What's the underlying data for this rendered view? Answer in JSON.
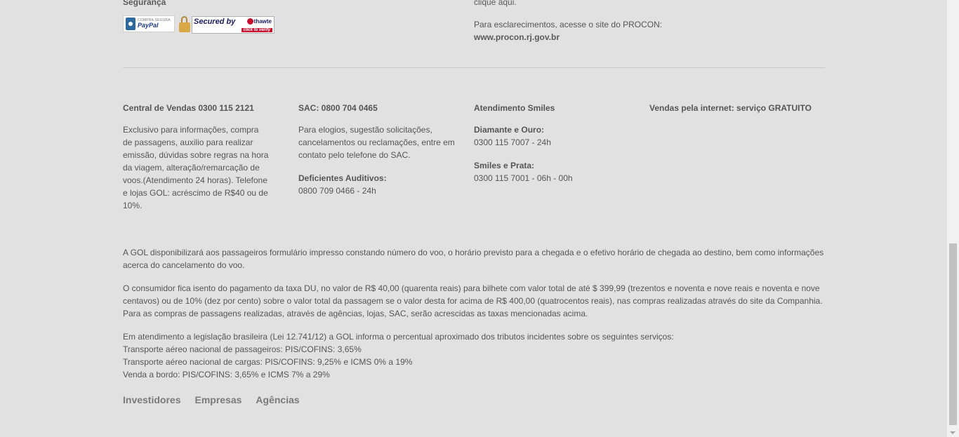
{
  "security": {
    "title": "Segurança",
    "paypal_small": "COMPRA SEGURA",
    "paypal_brand": "PayPal",
    "thawte_secured": "Secured by",
    "thawte_brand": "thawte",
    "thawte_verify": "click to verify"
  },
  "procon": {
    "clique_aqui": "clique aqui.",
    "text": "Para esclarecimentos, acesse o site do PROCON:",
    "link": "www.procon.rj.gov.br"
  },
  "columns": {
    "central": {
      "title": "Central de Vendas 0300 115 2121",
      "text": "Exclusivo para informações, compra de passagens, auxilio para realizar emissão, dúvidas sobre regras na hora da viagem, alteração/remarcação de voos.(Atendimento 24 horas). Telefone e lojas GOL: acréscimo de R$40 ou de 10%."
    },
    "sac": {
      "title": "SAC: 0800 704 0465",
      "text": "Para elogios, sugestão solicitações, cancelamentos ou reclamações, entre em contato pelo telefone do SAC.",
      "sub_title": "Deficientes Auditivos:",
      "sub_text": "0800 709 0466 - 24h"
    },
    "smiles": {
      "title": "Atendimento Smiles",
      "diamante_title": "Diamante e Ouro:",
      "diamante_text": "0300 115 7007 - 24h",
      "prata_title": "Smiles e Prata:",
      "prata_text": "0300 115 7001 - 06h - 00h"
    },
    "internet": {
      "title": "Vendas pela internet: serviço GRATUITO"
    }
  },
  "legal": {
    "p1": "A GOL disponibilizará aos passageiros formulário impresso constando número do voo, o horário previsto para a chegada e o efetivo horário de chegada ao destino, bem como informações acerca do cancelamento do voo.",
    "p2_line1": "O consumidor fica isento do pagamento da taxa DU, no valor de R$ 40,00 (quarenta reais) para bilhete com valor total de até $ 399,99 (trezentos e noventa e nove reais e noventa e nove centavos) ou de 10% (dez por cento) sobre o valor total da passagem se o valor desta for acima de R$ 400,00 (quatrocentos reais), nas compras realizadas através do site da Companhia.",
    "p2_line2": "Para as compras de passagens realizadas, através de agências, lojas, SAC, serão acrescidas as taxas mencionadas acima.",
    "p3_line1": "Em atendimento a legislação brasileira (Lei 12.741/12) a GOL informa o percentual aproximado dos tributos incidentes sobre os seguintes serviços:",
    "p3_line2": "Transporte aéreo nacional de passageiros: PIS/COFINS: 3,65%",
    "p3_line3": "Transporte aéreo nacional de cargas: PIS/COFINS: 9,25% e ICMS 0% a 19%",
    "p3_line4": "Venda a bordo: PIS/COFINS: 3,65% e ICMS 7% a 29%"
  },
  "footer_links": {
    "investidores": "Investidores",
    "empresas": "Empresas",
    "agencias": "Agências"
  },
  "colors": {
    "background": "#e1e1e1",
    "text": "#555555",
    "link_gray": "#7a7a7a"
  }
}
